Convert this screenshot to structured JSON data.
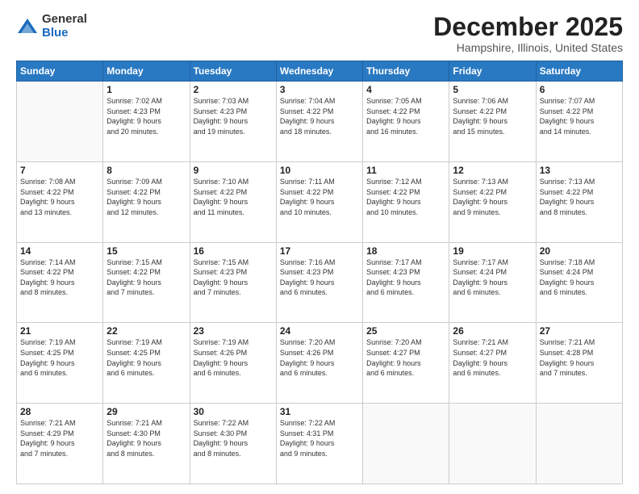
{
  "logo": {
    "general": "General",
    "blue": "Blue"
  },
  "title": {
    "month": "December 2025",
    "location": "Hampshire, Illinois, United States"
  },
  "weekdays": [
    "Sunday",
    "Monday",
    "Tuesday",
    "Wednesday",
    "Thursday",
    "Friday",
    "Saturday"
  ],
  "weeks": [
    [
      {
        "day": "",
        "info": ""
      },
      {
        "day": "1",
        "info": "Sunrise: 7:02 AM\nSunset: 4:23 PM\nDaylight: 9 hours\nand 20 minutes."
      },
      {
        "day": "2",
        "info": "Sunrise: 7:03 AM\nSunset: 4:23 PM\nDaylight: 9 hours\nand 19 minutes."
      },
      {
        "day": "3",
        "info": "Sunrise: 7:04 AM\nSunset: 4:22 PM\nDaylight: 9 hours\nand 18 minutes."
      },
      {
        "day": "4",
        "info": "Sunrise: 7:05 AM\nSunset: 4:22 PM\nDaylight: 9 hours\nand 16 minutes."
      },
      {
        "day": "5",
        "info": "Sunrise: 7:06 AM\nSunset: 4:22 PM\nDaylight: 9 hours\nand 15 minutes."
      },
      {
        "day": "6",
        "info": "Sunrise: 7:07 AM\nSunset: 4:22 PM\nDaylight: 9 hours\nand 14 minutes."
      }
    ],
    [
      {
        "day": "7",
        "info": "Sunrise: 7:08 AM\nSunset: 4:22 PM\nDaylight: 9 hours\nand 13 minutes."
      },
      {
        "day": "8",
        "info": "Sunrise: 7:09 AM\nSunset: 4:22 PM\nDaylight: 9 hours\nand 12 minutes."
      },
      {
        "day": "9",
        "info": "Sunrise: 7:10 AM\nSunset: 4:22 PM\nDaylight: 9 hours\nand 11 minutes."
      },
      {
        "day": "10",
        "info": "Sunrise: 7:11 AM\nSunset: 4:22 PM\nDaylight: 9 hours\nand 10 minutes."
      },
      {
        "day": "11",
        "info": "Sunrise: 7:12 AM\nSunset: 4:22 PM\nDaylight: 9 hours\nand 10 minutes."
      },
      {
        "day": "12",
        "info": "Sunrise: 7:13 AM\nSunset: 4:22 PM\nDaylight: 9 hours\nand 9 minutes."
      },
      {
        "day": "13",
        "info": "Sunrise: 7:13 AM\nSunset: 4:22 PM\nDaylight: 9 hours\nand 8 minutes."
      }
    ],
    [
      {
        "day": "14",
        "info": "Sunrise: 7:14 AM\nSunset: 4:22 PM\nDaylight: 9 hours\nand 8 minutes."
      },
      {
        "day": "15",
        "info": "Sunrise: 7:15 AM\nSunset: 4:22 PM\nDaylight: 9 hours\nand 7 minutes."
      },
      {
        "day": "16",
        "info": "Sunrise: 7:15 AM\nSunset: 4:23 PM\nDaylight: 9 hours\nand 7 minutes."
      },
      {
        "day": "17",
        "info": "Sunrise: 7:16 AM\nSunset: 4:23 PM\nDaylight: 9 hours\nand 6 minutes."
      },
      {
        "day": "18",
        "info": "Sunrise: 7:17 AM\nSunset: 4:23 PM\nDaylight: 9 hours\nand 6 minutes."
      },
      {
        "day": "19",
        "info": "Sunrise: 7:17 AM\nSunset: 4:24 PM\nDaylight: 9 hours\nand 6 minutes."
      },
      {
        "day": "20",
        "info": "Sunrise: 7:18 AM\nSunset: 4:24 PM\nDaylight: 9 hours\nand 6 minutes."
      }
    ],
    [
      {
        "day": "21",
        "info": "Sunrise: 7:19 AM\nSunset: 4:25 PM\nDaylight: 9 hours\nand 6 minutes."
      },
      {
        "day": "22",
        "info": "Sunrise: 7:19 AM\nSunset: 4:25 PM\nDaylight: 9 hours\nand 6 minutes."
      },
      {
        "day": "23",
        "info": "Sunrise: 7:19 AM\nSunset: 4:26 PM\nDaylight: 9 hours\nand 6 minutes."
      },
      {
        "day": "24",
        "info": "Sunrise: 7:20 AM\nSunset: 4:26 PM\nDaylight: 9 hours\nand 6 minutes."
      },
      {
        "day": "25",
        "info": "Sunrise: 7:20 AM\nSunset: 4:27 PM\nDaylight: 9 hours\nand 6 minutes."
      },
      {
        "day": "26",
        "info": "Sunrise: 7:21 AM\nSunset: 4:27 PM\nDaylight: 9 hours\nand 6 minutes."
      },
      {
        "day": "27",
        "info": "Sunrise: 7:21 AM\nSunset: 4:28 PM\nDaylight: 9 hours\nand 7 minutes."
      }
    ],
    [
      {
        "day": "28",
        "info": "Sunrise: 7:21 AM\nSunset: 4:29 PM\nDaylight: 9 hours\nand 7 minutes."
      },
      {
        "day": "29",
        "info": "Sunrise: 7:21 AM\nSunset: 4:30 PM\nDaylight: 9 hours\nand 8 minutes."
      },
      {
        "day": "30",
        "info": "Sunrise: 7:22 AM\nSunset: 4:30 PM\nDaylight: 9 hours\nand 8 minutes."
      },
      {
        "day": "31",
        "info": "Sunrise: 7:22 AM\nSunset: 4:31 PM\nDaylight: 9 hours\nand 9 minutes."
      },
      {
        "day": "",
        "info": ""
      },
      {
        "day": "",
        "info": ""
      },
      {
        "day": "",
        "info": ""
      }
    ]
  ]
}
